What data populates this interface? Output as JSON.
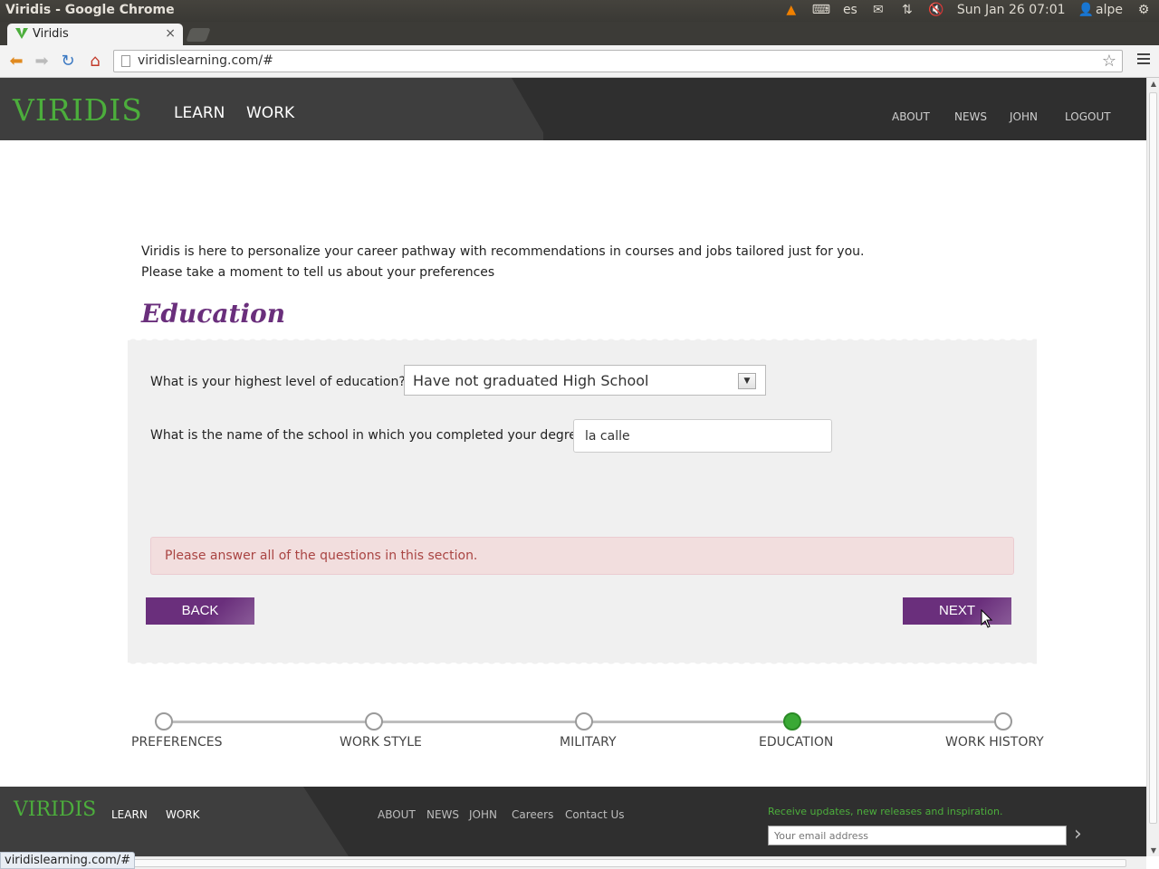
{
  "os": {
    "window_title": "Viridis - Google Chrome",
    "keyboard_layout": "es",
    "datetime": "Sun Jan 26 07:01",
    "user": "alpe"
  },
  "browser": {
    "tab_title": "Viridis",
    "url": "viridislearning.com/#",
    "status_url": "viridislearning.com/#"
  },
  "header": {
    "logo_text": "VIRIDIS",
    "nav_main": [
      "LEARN",
      "WORK"
    ],
    "nav_right": [
      "ABOUT",
      "NEWS",
      "JOHN",
      "LOGOUT"
    ]
  },
  "intro": {
    "line1": "Viridis is here to personalize your career pathway with recommendations in courses and jobs tailored just for you.",
    "line2": "Please take a moment to tell us about your preferences"
  },
  "section": {
    "title": "Education",
    "q1_label": "What is your highest level of education?",
    "q1_value": "Have not graduated High School",
    "q2_label": "What is the name of the school in which you completed your degree?",
    "q2_value": "la calle",
    "error": "Please answer all of the questions in this section.",
    "back_label": "BACK",
    "next_label": "NEXT"
  },
  "progress": {
    "steps": [
      "PREFERENCES",
      "WORK STYLE",
      "MILITARY",
      "EDUCATION",
      "WORK HISTORY"
    ],
    "active_index": 3
  },
  "footer": {
    "logo_text": "VIRIDIS",
    "nav_main": [
      "LEARN",
      "WORK"
    ],
    "links": [
      "ABOUT",
      "NEWS",
      "JOHN",
      "Careers",
      "Contact Us"
    ],
    "newsletter_text": "Receive updates, new releases and inspiration.",
    "email_placeholder": "Your email address"
  },
  "colors": {
    "brand_green": "#4cae3c",
    "brand_purple": "#6a2f7c",
    "header_dark": "#2f2f2f"
  }
}
